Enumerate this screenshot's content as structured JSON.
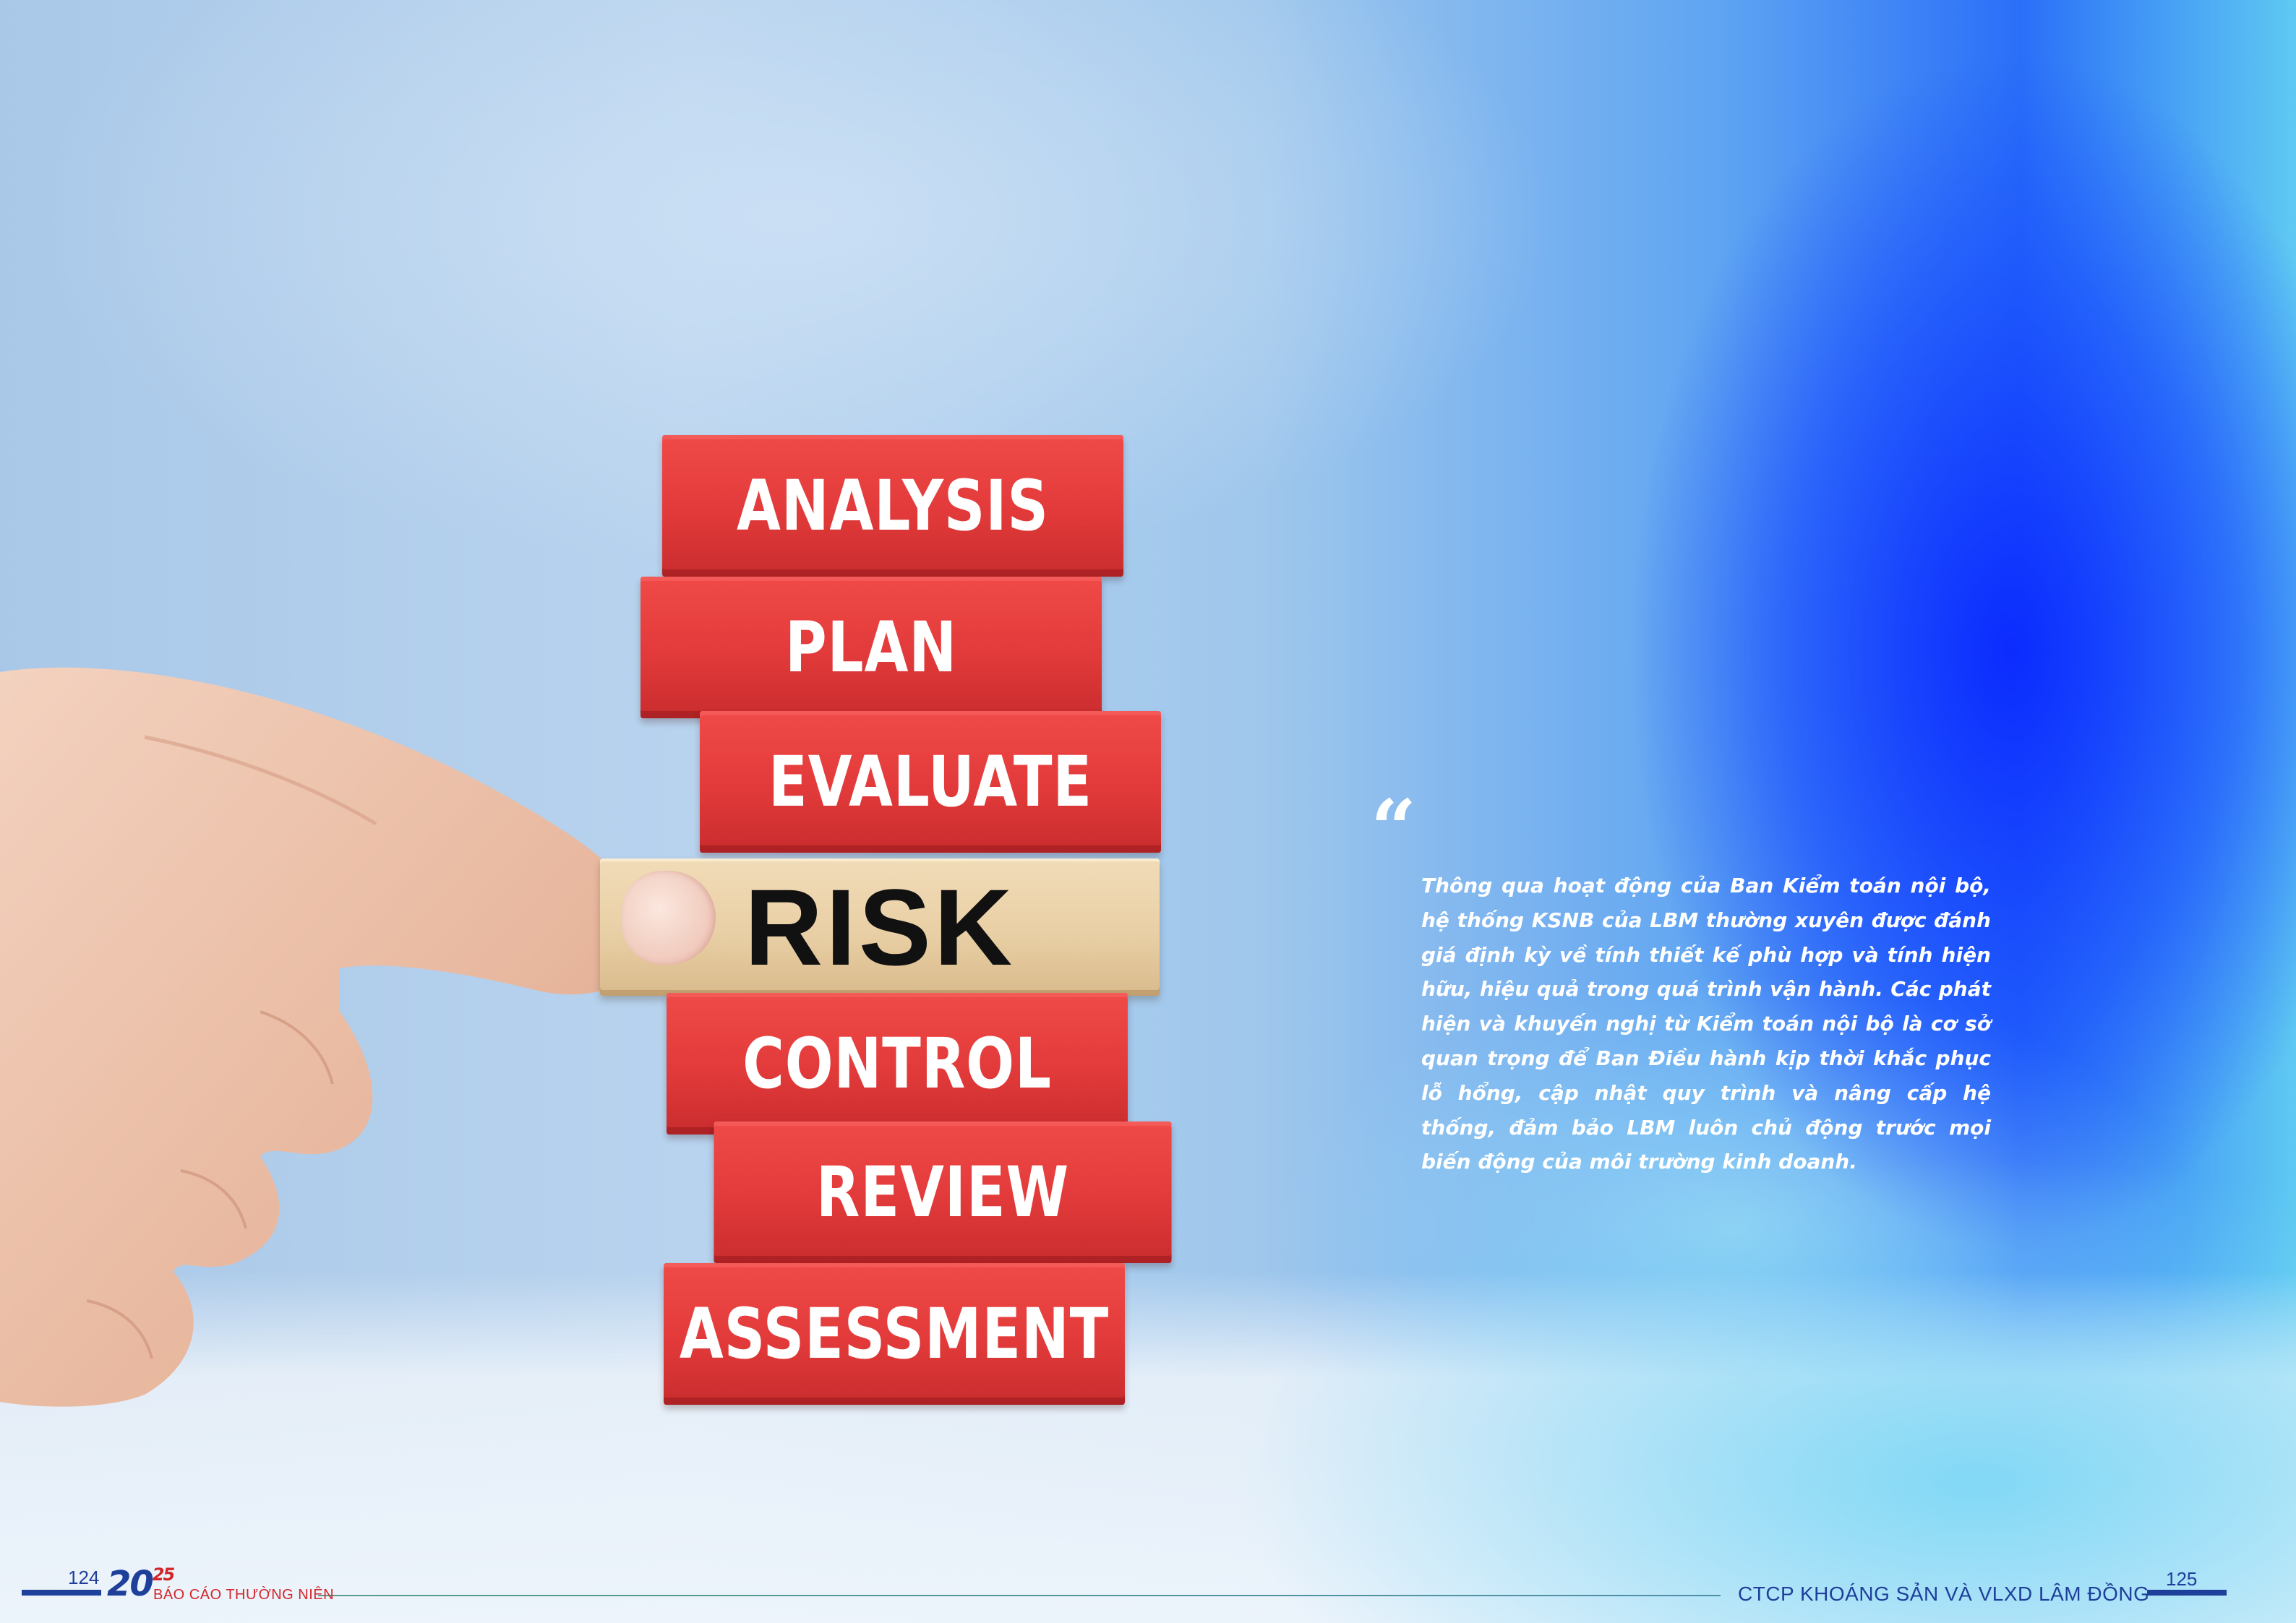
{
  "photo": {
    "blocks": [
      {
        "label": "ANALYSIS"
      },
      {
        "label": "PLAN"
      },
      {
        "label": "EVALUATE"
      },
      {
        "label": "RISK"
      },
      {
        "label": "CONTROL"
      },
      {
        "label": "REVIEW"
      },
      {
        "label": "ASSESSMENT"
      }
    ]
  },
  "quote": {
    "mark": "“",
    "text": "Thông qua hoạt động của Ban Kiểm toán nội bộ, hệ thống KSNB của LBM thường xuyên được đánh giá định kỳ về tính thiết kế phù hợp và tính hiện hữu, hiệu quả trong quá trình vận hành. Các phát hiện và khuyến nghị từ Kiểm toán nội bộ là cơ sở quan trọng để Ban Điều hành kịp thời khắc phục lỗ hổng, cập nhật quy trình và nâng cấp hệ thống, đảm bảo LBM luôn chủ động trước mọi biến động của môi trường kinh doanh."
  },
  "footer": {
    "page_left": "124",
    "page_right": "125",
    "logo_year_main": "20",
    "logo_year_sup": "25",
    "report_label": "BÁO CÁO THƯỜNG NIÊN",
    "company_label": "CTCP KHOÁNG SẢN VÀ VLXD LÂM ĐỒNG"
  },
  "colors": {
    "block_red": "#e23a3a",
    "block_wood": "#e9cfa5",
    "footer_blue": "#1e3f9a",
    "footer_red": "#d2262a"
  }
}
